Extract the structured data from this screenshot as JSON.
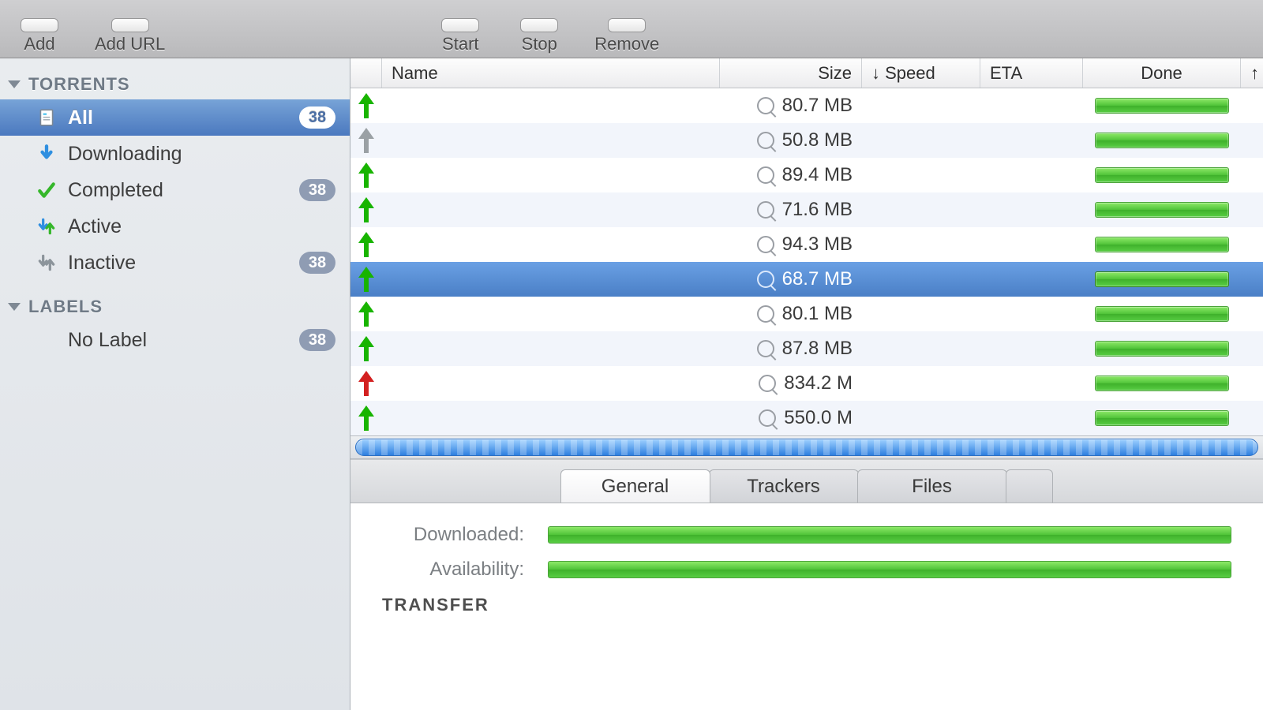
{
  "toolbar": {
    "add": "Add",
    "add_url": "Add URL",
    "start": "Start",
    "stop": "Stop",
    "remove": "Remove"
  },
  "sidebar": {
    "sections": [
      {
        "title": "TORRENTS",
        "items": [
          {
            "icon": "doc",
            "label": "All",
            "badge": "38",
            "selected": true
          },
          {
            "icon": "dl",
            "label": "Downloading",
            "badge": "",
            "selected": false
          },
          {
            "icon": "check",
            "label": "Completed",
            "badge": "38",
            "selected": false
          },
          {
            "icon": "active",
            "label": "Active",
            "badge": "",
            "selected": false
          },
          {
            "icon": "inactive",
            "label": "Inactive",
            "badge": "38",
            "selected": false
          }
        ]
      },
      {
        "title": "LABELS",
        "items": [
          {
            "icon": "",
            "label": "No Label",
            "badge": "38",
            "selected": false
          }
        ]
      }
    ]
  },
  "columns": {
    "name": "Name",
    "size": "Size",
    "speed": "↓ Speed",
    "eta": "ETA",
    "done": "Done"
  },
  "rows": [
    {
      "status": "green",
      "size": "80.7 MB",
      "selected": false
    },
    {
      "status": "gray",
      "size": "50.8 MB",
      "selected": false
    },
    {
      "status": "green",
      "size": "89.4 MB",
      "selected": false
    },
    {
      "status": "green",
      "size": "71.6 MB",
      "selected": false
    },
    {
      "status": "green",
      "size": "94.3 MB",
      "selected": false
    },
    {
      "status": "green",
      "size": "68.7 MB",
      "selected": true
    },
    {
      "status": "green",
      "size": "80.1 MB",
      "selected": false
    },
    {
      "status": "green",
      "size": "87.8 MB",
      "selected": false
    },
    {
      "status": "red",
      "size": "834.2 M",
      "selected": false
    },
    {
      "status": "green",
      "size": "550.0 M",
      "selected": false
    }
  ],
  "tabs": {
    "general": "General",
    "trackers": "Trackers",
    "files": "Files"
  },
  "details": {
    "downloaded": "Downloaded:",
    "availability": "Availability:",
    "transfer": "TRANSFER"
  }
}
